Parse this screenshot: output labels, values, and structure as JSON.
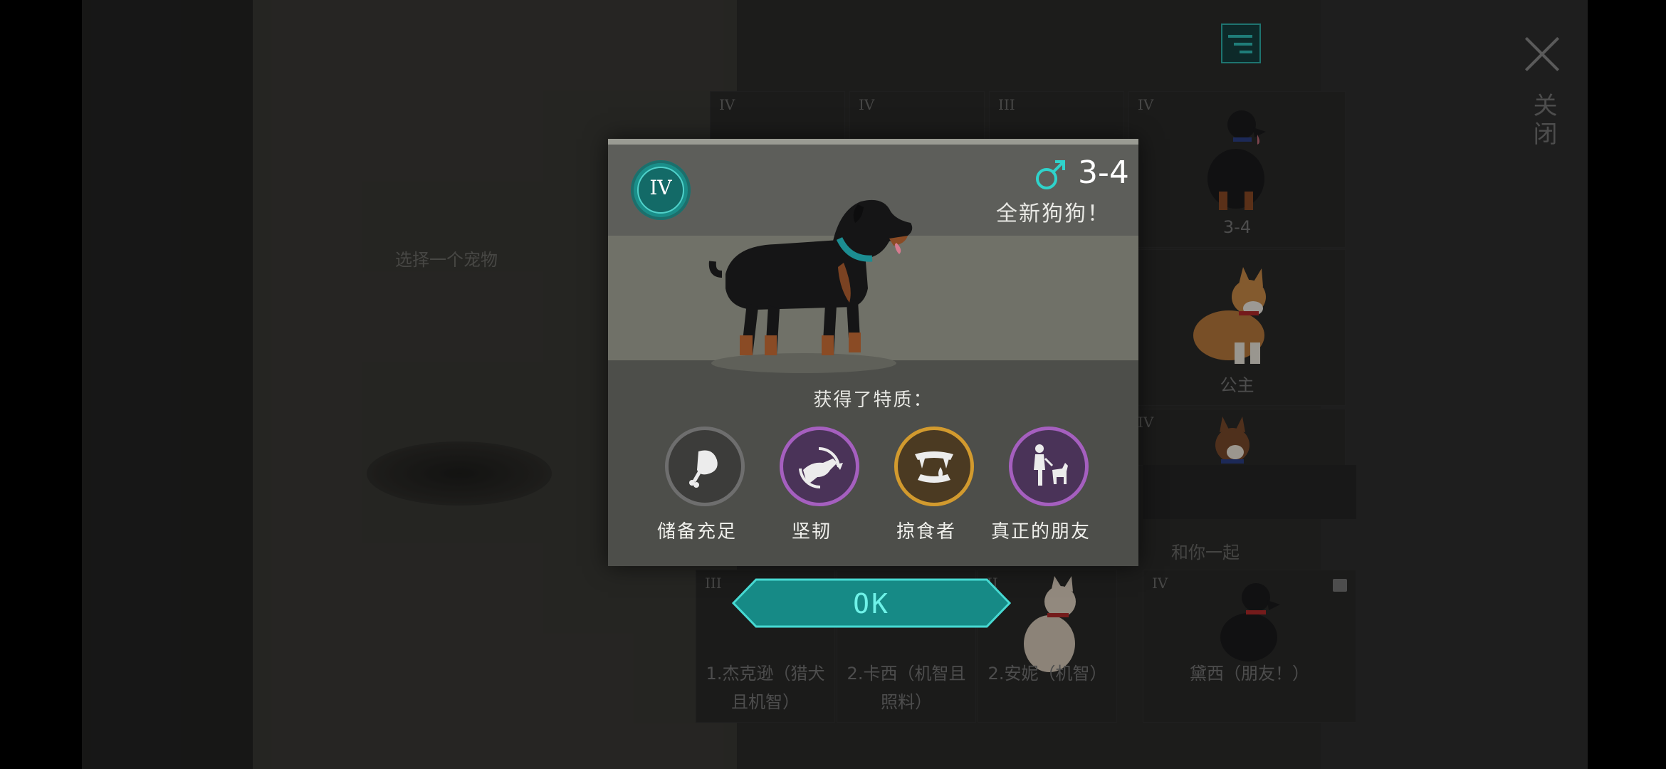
{
  "background": {
    "select_prompt": "选择一个宠物",
    "close_label": "关闭",
    "section_title": "和你一起",
    "top_cards": [
      {
        "rank": "IV",
        "name": ""
      },
      {
        "rank": "IV",
        "name": ""
      },
      {
        "rank": "III",
        "name": ""
      },
      {
        "rank": "IV",
        "name": "3-4"
      }
    ],
    "side_cards": [
      {
        "rank": "",
        "name": "公主"
      },
      {
        "rank": "IV",
        "name": ""
      }
    ],
    "bottom_cards": [
      {
        "rank": "III",
        "name": "1.杰克逊（猎犬且机智）"
      },
      {
        "rank": "",
        "name": "2.卡西（机智且照料）"
      },
      {
        "rank": "II",
        "name": "2.安妮（机智）"
      },
      {
        "rank": "IV",
        "name": "黛西（朋友！）"
      }
    ]
  },
  "dialog": {
    "rank": "IV",
    "gender_icon": "male-symbol-icon",
    "age": "3-4",
    "subtitle": "全新狗狗！",
    "traits_title": "获得了特质：",
    "traits": [
      {
        "label": "储备充足",
        "icon": "meat-icon",
        "ring_color": "#6e6e6e",
        "fill": "#3c3c3a"
      },
      {
        "label": "坚韧",
        "icon": "resilient-dog-icon",
        "ring_color": "#a55fbf",
        "fill": "#4a3358"
      },
      {
        "label": "掠食者",
        "icon": "fangs-icon",
        "ring_color": "#d29a2e",
        "fill": "#4b3a22"
      },
      {
        "label": "真正的朋友",
        "icon": "person-with-dog-icon",
        "ring_color": "#a55fbf",
        "fill": "#4a3358"
      }
    ],
    "ok_label": "OK"
  },
  "colors": {
    "accent": "#1f8f8a",
    "accent_light": "#6ff2e8"
  }
}
